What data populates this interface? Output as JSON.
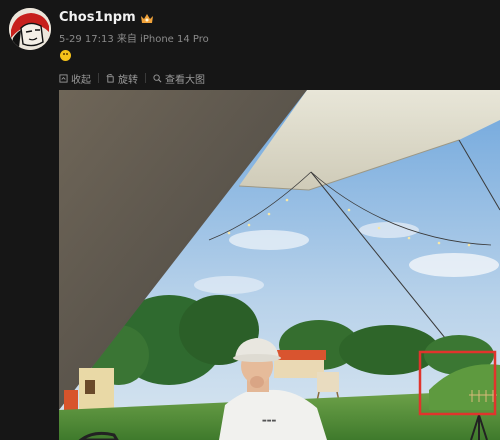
{
  "post": {
    "username": "Chos1npm",
    "meta": "5-29 17:13 来自 iPhone 14 Pro"
  },
  "toolbar": {
    "collapse_label": "收起",
    "repost_label": "旋转",
    "view_large_label": "查看大图"
  },
  "icons": {
    "collapse": "collapse-icon",
    "rotate": "rotate-icon",
    "view_large": "magnifier-icon"
  },
  "colors": {
    "background": "#161616",
    "highlight_box": "#e0342c",
    "sky": "#9fc3e6"
  }
}
